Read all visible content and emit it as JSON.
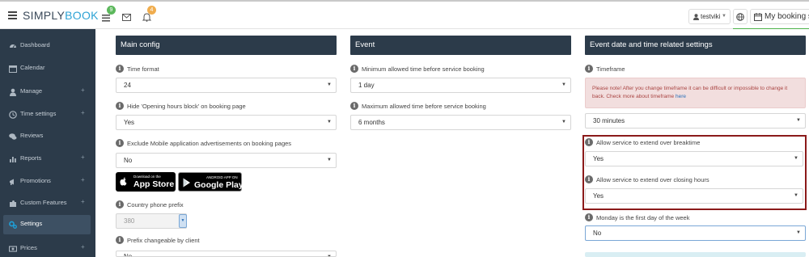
{
  "app": {
    "logo_part1": "SIMPLY",
    "logo_part2": "BOOK",
    "tasks_badge": "9",
    "notifications_badge": "4",
    "user_name": "testviki",
    "booking_site_label": "My booking s"
  },
  "sidebar": {
    "items": [
      {
        "label": "Dashboard",
        "icon": "dashboard-icon"
      },
      {
        "label": "Calendar",
        "icon": "calendar-icon"
      },
      {
        "label": "Manage",
        "icon": "user-icon",
        "expand": "+"
      },
      {
        "label": "Time settings",
        "icon": "clock-icon",
        "expand": "+"
      },
      {
        "label": "Reviews",
        "icon": "comments-icon"
      },
      {
        "label": "Reports",
        "icon": "bar-chart-icon",
        "expand": "+"
      },
      {
        "label": "Promotions",
        "icon": "bullhorn-icon",
        "expand": "+"
      },
      {
        "label": "Custom Features",
        "icon": "puzzle-icon",
        "expand": "+"
      },
      {
        "label": "Settings",
        "icon": "gears-icon",
        "active": true
      },
      {
        "label": "Prices",
        "icon": "money-icon",
        "expand": "+"
      }
    ]
  },
  "main_config": {
    "title": "Main config",
    "time_format_label": "Time format",
    "time_format_value": "24",
    "hide_opening_hours_label": "Hide 'Opening hours block' on booking page",
    "hide_opening_hours_value": "Yes",
    "exclude_mobile_ads_label": "Exclude Mobile application advertisements on booking pages",
    "exclude_mobile_ads_value": "No",
    "app_store_small": "Download on the",
    "app_store_big": "App Store",
    "google_play_small": "ANDROID APP ON",
    "google_play_big": "Google Play",
    "phone_prefix_label": "Country phone prefix",
    "phone_prefix_value": "380",
    "prefix_changeable_label": "Prefix changeable by client",
    "prefix_changeable_value": "No"
  },
  "event": {
    "title": "Event",
    "min_time_label": "Minimum allowed time before service booking",
    "min_time_value": "1 day",
    "max_time_label": "Maximum allowed time before service booking",
    "max_time_value": "6 months"
  },
  "event_date": {
    "title": "Event date and time related settings",
    "timeframe_label": "Timeframe",
    "notice_text": "Please note! After you change timeframe it can be difficult or impossible to change it back. Check more about timeframe ",
    "notice_link": "here",
    "timeframe_value": "30 minutes",
    "breaktime_label": "Allow service to extend over breaktime",
    "breaktime_value": "Yes",
    "closing_hours_label": "Allow service to extend over closing hours",
    "closing_hours_value": "Yes",
    "monday_first_label": "Monday is the first day of the week",
    "monday_first_value": "No"
  }
}
